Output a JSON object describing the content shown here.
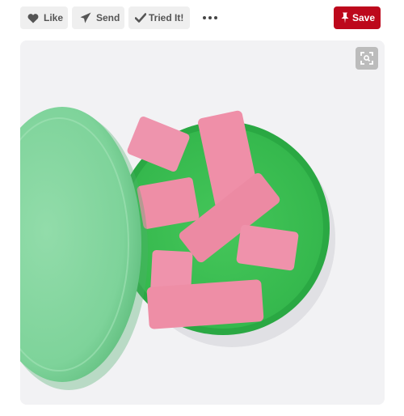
{
  "toolbar": {
    "like": {
      "label": "Like",
      "icon": "heart-icon"
    },
    "send": {
      "label": "Send",
      "icon": "send-icon"
    },
    "tried": {
      "label": "Tried It!",
      "icon": "check-icon"
    },
    "more": {
      "icon": "more-dots-icon"
    },
    "save": {
      "label": "Save",
      "icon": "pin-icon",
      "color": "#bd081c"
    }
  },
  "image": {
    "zoom_icon": "visual-search-icon",
    "colors": {
      "tin": "#35b84d",
      "lid": "#7ed39a",
      "eraser": "#ee8ea6",
      "background": "#f2f2f4"
    }
  }
}
